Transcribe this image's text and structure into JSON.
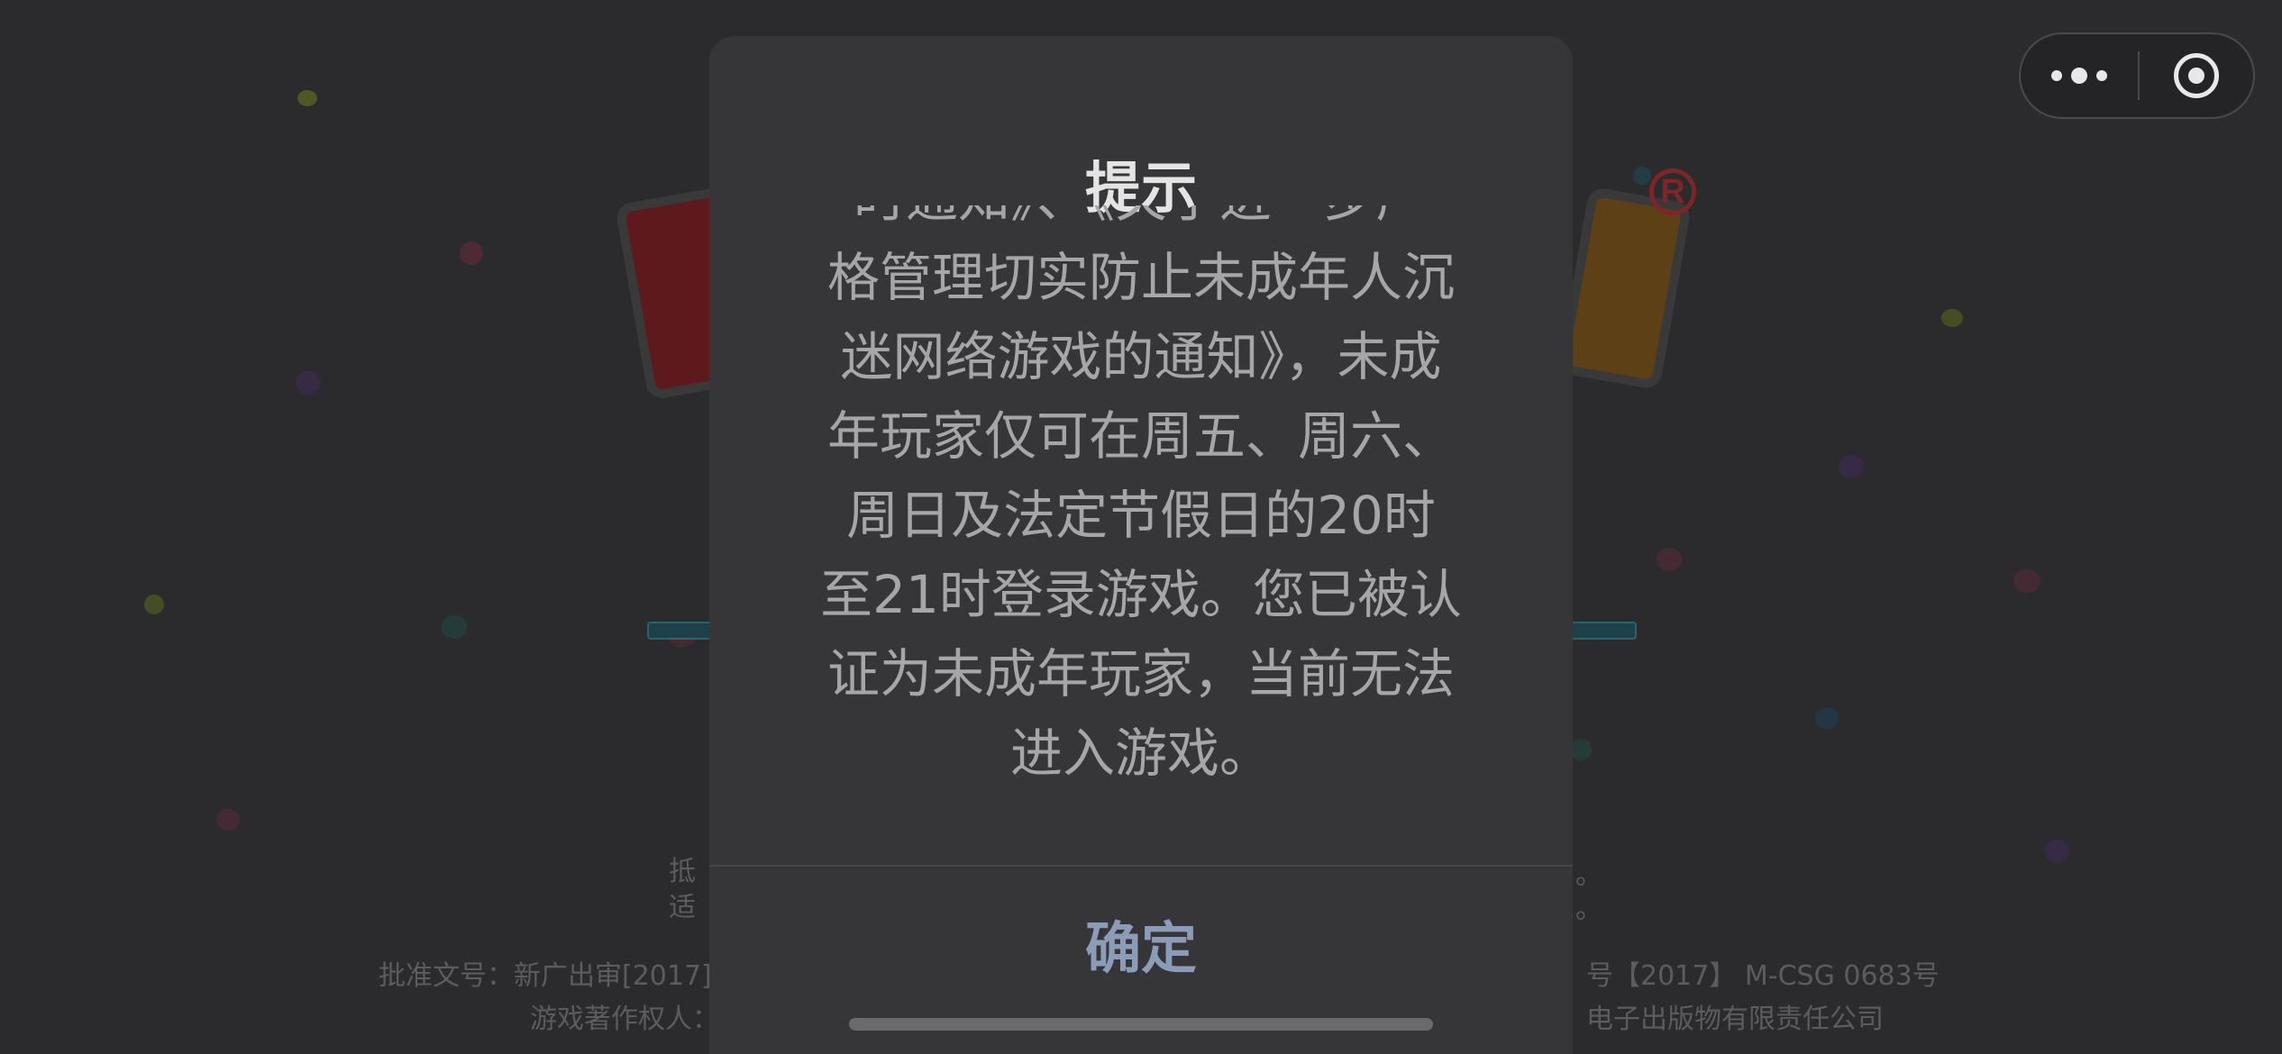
{
  "capsule": {
    "more_icon": "more-dots-icon",
    "close_icon": "target-circle-icon"
  },
  "modal": {
    "title": "提示",
    "message_lines": [
      "时通知》、《关于进一步严",
      "格管理切实防止未成年人沉",
      "迷网络游戏的通知》，未成",
      "年玩家仅可在周五、周六、",
      "周日及法定节假日的20时",
      "至21时登录游戏。您已被认",
      "证为未成年玩家，当前无法",
      "进入游戏。"
    ],
    "confirm_label": "确定"
  },
  "background": {
    "notice_line1_left": "抵",
    "notice_line1_right": "。",
    "notice_line2_left": "适",
    "notice_line2_right": "。",
    "approval_left": "批准文号：新广出审[2017]",
    "approval_right": "号【2017】 M-CSG 0683号",
    "copyright_left": "游戏著作权人：",
    "copyright_right": "电子出版物有限责任公司"
  },
  "colors": {
    "overlay_bg": "#2b2b2d",
    "modal_bg": "#363638",
    "title_text": "#e4e4e4",
    "body_text": "#a6a6a8",
    "confirm_text": "#8c9cb8"
  }
}
